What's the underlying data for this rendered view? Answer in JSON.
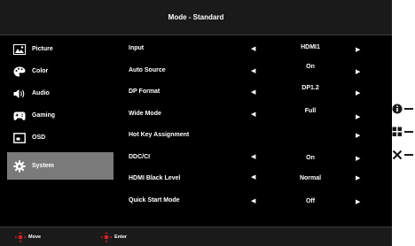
{
  "title": "Mode - Standard",
  "sidebar": {
    "items": [
      {
        "label": "Picture",
        "icon": "picture-icon"
      },
      {
        "label": "Color",
        "icon": "palette-icon"
      },
      {
        "label": "Audio",
        "icon": "speaker-icon"
      },
      {
        "label": "Gaming",
        "icon": "gamepad-icon"
      },
      {
        "label": "OSD",
        "icon": "osd-icon"
      },
      {
        "label": "System",
        "icon": "gear-icon",
        "active": true
      }
    ]
  },
  "settings": [
    {
      "label": "Input",
      "value": "HDMI1",
      "left_arrow": true,
      "right_arrow": true
    },
    {
      "label": "Auto Source",
      "value": "On",
      "left_arrow": true,
      "right_arrow": true
    },
    {
      "label": "DP Format",
      "value": "DP1.2",
      "left_arrow": true,
      "right_arrow": true
    },
    {
      "label": "Wide Mode",
      "value": "Full",
      "left_arrow": true,
      "right_arrow": true
    },
    {
      "label": "Hot Key Assignment",
      "value": "",
      "left_arrow": false,
      "right_arrow": true
    },
    {
      "label": "DDC/CI",
      "value": "On",
      "left_arrow": true,
      "right_arrow": true
    },
    {
      "label": "HDMI Black Level",
      "value": "Normal",
      "left_arrow": true,
      "right_arrow": true
    },
    {
      "label": "Quick Start Mode",
      "value": "Off",
      "left_arrow": true,
      "right_arrow": true
    }
  ],
  "arrows": {
    "left": "◀",
    "right": "▶"
  },
  "footer": {
    "move_label": "Move",
    "enter_label": "Enter"
  },
  "side_keys": [
    {
      "icon": "info-icon"
    },
    {
      "icon": "grid-icon"
    },
    {
      "icon": "close-icon"
    }
  ],
  "colors": {
    "background": "#000000",
    "bar": "#1a1a1a",
    "active": "#7a7a7a",
    "accent": "#d4202a"
  }
}
